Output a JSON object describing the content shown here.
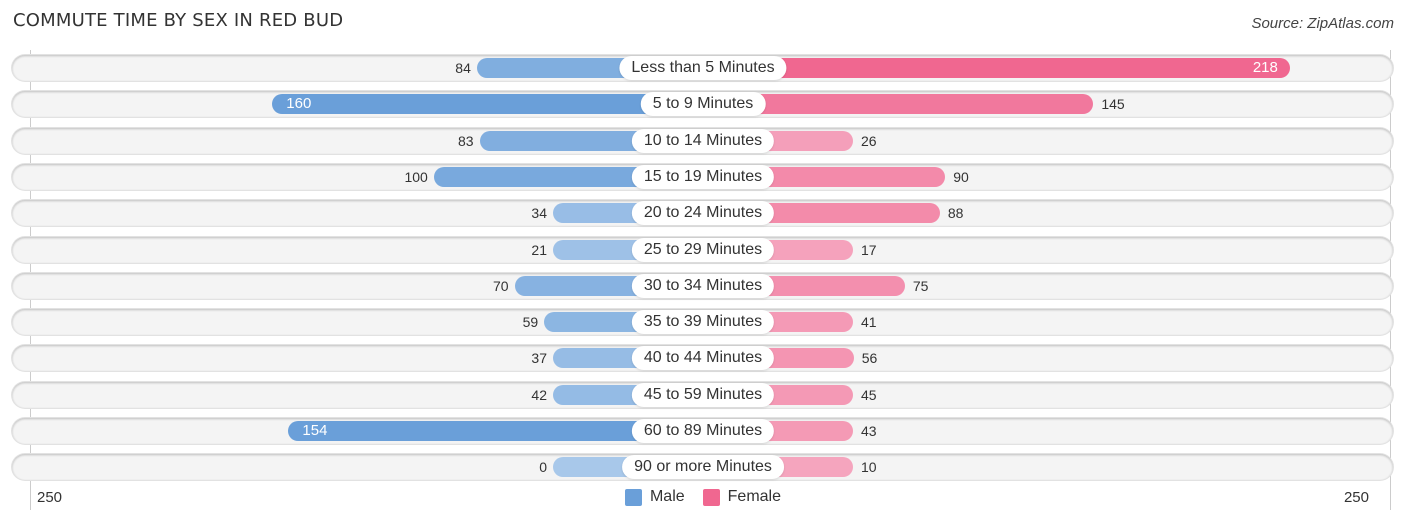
{
  "header": {
    "title": "COMMUTE TIME BY SEX IN RED BUD",
    "source": "Source: ZipAtlas.com"
  },
  "colors": {
    "male": "#6a9fd9",
    "male_light": "#a8c8ea",
    "female": "#f06790",
    "female_light": "#f5a8c0"
  },
  "chart_data": {
    "type": "bar",
    "orientation": "horizontal-diverging",
    "title": "COMMUTE TIME BY SEX IN RED BUD",
    "categories": [
      "Less than 5 Minutes",
      "5 to 9 Minutes",
      "10 to 14 Minutes",
      "15 to 19 Minutes",
      "20 to 24 Minutes",
      "25 to 29 Minutes",
      "30 to 34 Minutes",
      "35 to 39 Minutes",
      "40 to 44 Minutes",
      "45 to 59 Minutes",
      "60 to 89 Minutes",
      "90 or more Minutes"
    ],
    "series": [
      {
        "name": "Male",
        "values": [
          84,
          160,
          83,
          100,
          34,
          21,
          70,
          59,
          37,
          42,
          154,
          0
        ]
      },
      {
        "name": "Female",
        "values": [
          218,
          145,
          26,
          90,
          88,
          17,
          75,
          41,
          56,
          45,
          43,
          10
        ]
      }
    ],
    "axis": {
      "left_tick": "250",
      "right_tick": "250",
      "range": [
        -250,
        250
      ]
    },
    "legend": {
      "position": "bottom-center",
      "items": [
        "Male",
        "Female"
      ]
    },
    "grid": false
  }
}
